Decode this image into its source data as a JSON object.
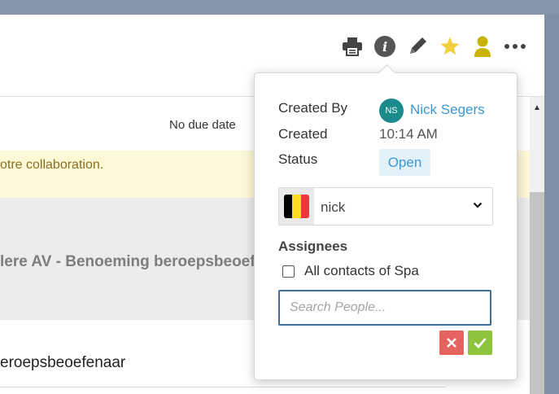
{
  "due_label": "No due date",
  "notice_text": "otre collaboration.",
  "case_title": "lere AV - Benoeming beroepsbeoefe",
  "section_title": "eroepsbeoefenaar",
  "toolbar": {
    "icons": [
      "print-icon",
      "info-icon",
      "pencil-icon",
      "star-icon",
      "user-icon",
      "more-icon"
    ],
    "star_color": "#f2cf3c",
    "user_color": "#c8b400"
  },
  "popover": {
    "created_by_label": "Created By",
    "creator_initials": "NS",
    "creator_name": "Nick Segers",
    "created_label": "Created",
    "created_value": "10:14 AM",
    "status_label": "Status",
    "status_value": "Open",
    "contact_select": {
      "flag": "belgium-flag",
      "flag_colors": [
        "#000000",
        "#fdda24",
        "#ef3340"
      ],
      "selected": "nick"
    },
    "assignees_label": "Assignees",
    "all_contacts_label": "All contacts of Spa",
    "all_contacts_checked": false,
    "search_placeholder": "Search People...",
    "cancel_icon": "close-icon",
    "confirm_icon": "checkmark-icon"
  }
}
